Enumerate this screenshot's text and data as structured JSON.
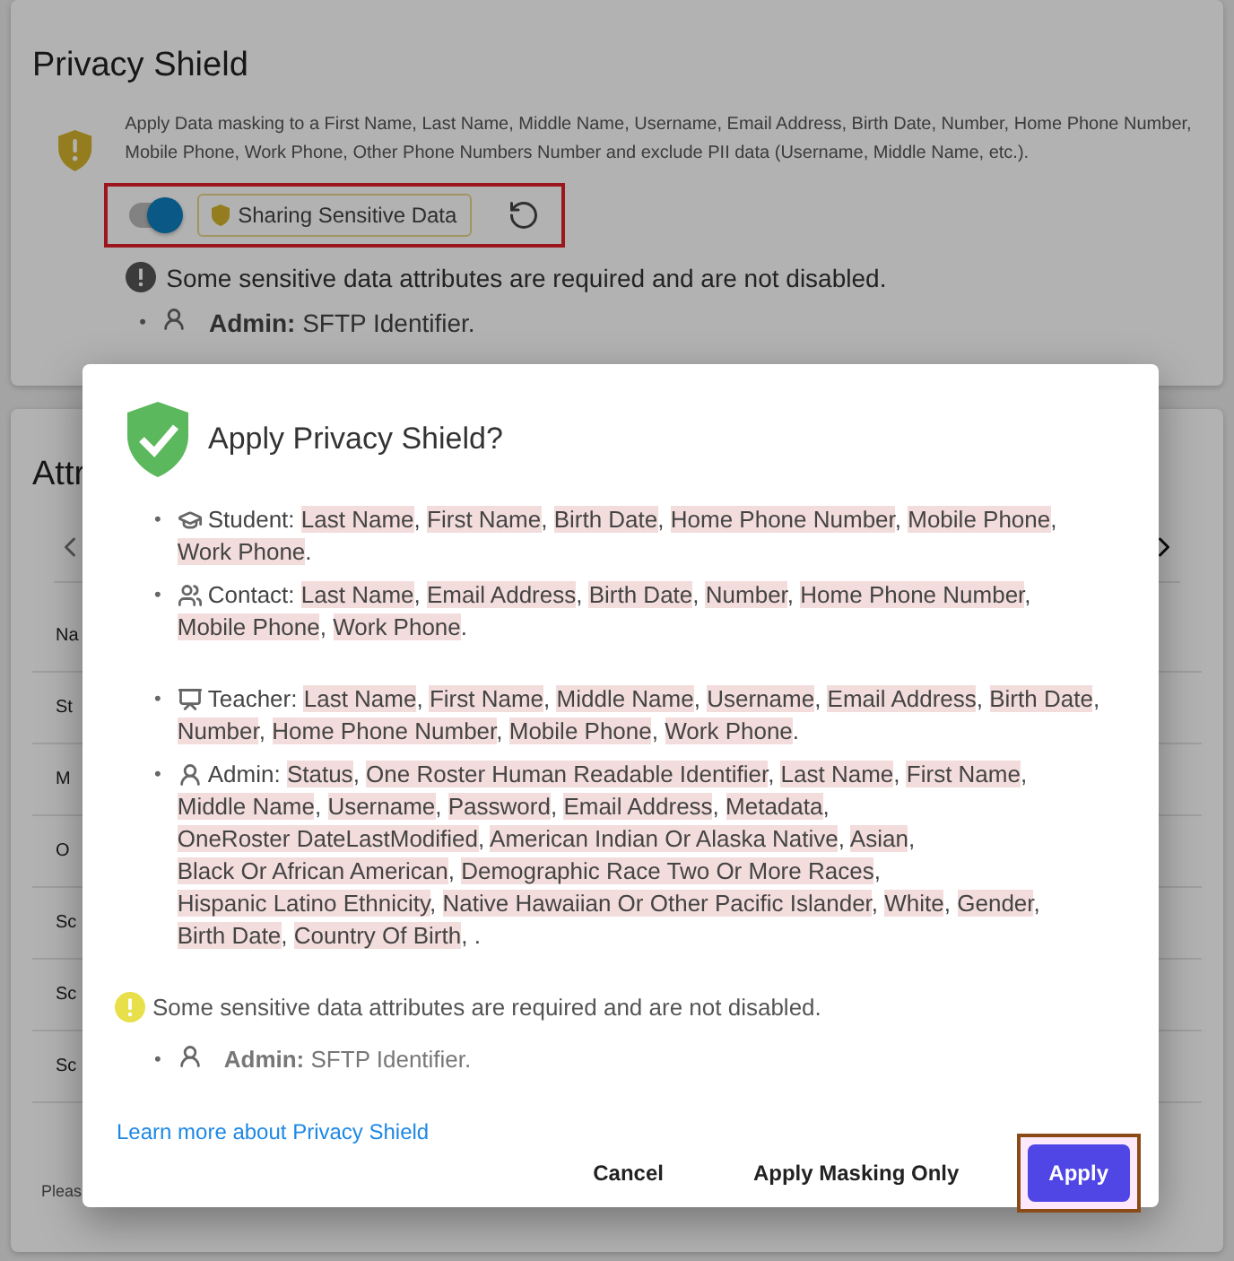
{
  "privacy_card": {
    "title": "Privacy Shield",
    "description": "Apply Data masking to a First Name, Last Name, Middle Name, Username, Email Address, Birth Date, Number, Home Phone Number, Mobile Phone, Work Phone, Other Phone Numbers Number and exclude PII data (Username, Middle Name, etc.).",
    "toggle": {
      "on": true,
      "annotated": true
    },
    "status_chip": "Sharing Sensitive Data",
    "warning": "Some sensitive data attributes are required and are not disabled.",
    "required": [
      {
        "role": "Admin:",
        "fields": "SFTP Identifier."
      }
    ]
  },
  "attributes_card": {
    "title": "Attr",
    "rows": [
      "Na",
      "St",
      "M",
      "O",
      "Sc",
      "Sc",
      "Sc"
    ],
    "footer": "Pleas"
  },
  "bullet": "•",
  "dialog": {
    "title": "Apply Privacy Shield?",
    "separator": ", ",
    "groups": [
      {
        "kind": "student",
        "role": "Student:",
        "fields": [
          "Last Name",
          "First Name",
          "Birth Date",
          "Home Phone Number",
          "Mobile Phone",
          "Work Phone"
        ],
        "ending": "."
      },
      {
        "kind": "contact",
        "role": "Contact:",
        "fields": [
          "Last Name",
          "Email Address",
          "Birth Date",
          "Number",
          "Home Phone Number",
          "Mobile Phone",
          "Work Phone"
        ],
        "ending": "."
      },
      {
        "kind": "teacher",
        "role": "Teacher:",
        "fields": [
          "Last Name",
          "First Name",
          "Middle Name",
          "Username",
          "Email Address",
          "Birth Date",
          "Number",
          "Home Phone Number",
          "Mobile Phone",
          "Work Phone"
        ],
        "ending": "."
      },
      {
        "kind": "admin",
        "role": "Admin:",
        "fields": [
          "Status",
          "One Roster Human Readable Identifier",
          "Last Name",
          "First Name",
          "Middle Name",
          "Username",
          "Password",
          "Email Address",
          "Metadata",
          "OneRoster DateLastModified",
          "American Indian Or Alaska Native",
          "Asian",
          "Black Or African American",
          "Demographic Race Two Or More Races",
          "Hispanic Latino Ethnicity",
          "Native Hawaiian Or Other Pacific Islander",
          "White",
          "Gender",
          "Birth Date",
          "Country Of Birth"
        ],
        "ending": ", ."
      }
    ],
    "warning": "Some sensitive data attributes are required and are not disabled.",
    "required": [
      {
        "role": "Admin:",
        "fields": "SFTP Identifier."
      }
    ],
    "link": "Learn more about Privacy Shield",
    "buttons": [
      {
        "label": "Cancel",
        "kind": "text",
        "annotated": false
      },
      {
        "label": "Apply Masking Only",
        "kind": "text",
        "annotated": false
      },
      {
        "label": "Apply",
        "kind": "primary",
        "annotated": true
      }
    ]
  }
}
